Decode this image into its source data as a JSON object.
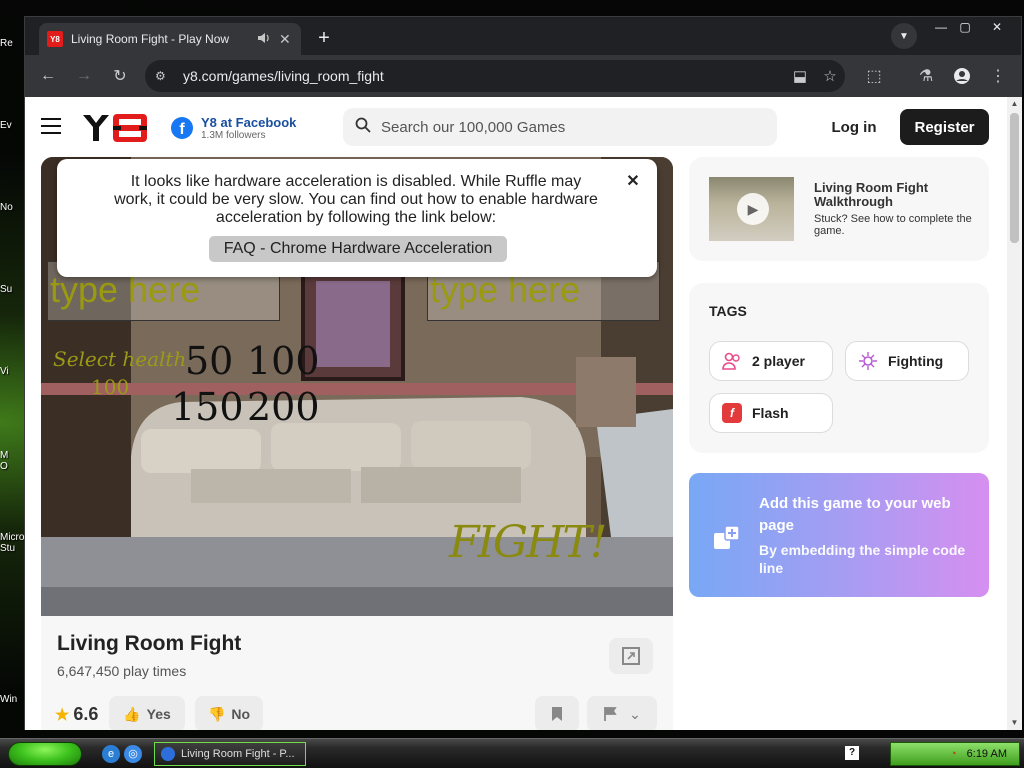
{
  "desktop": {
    "icons": [
      "Re",
      "Ev",
      "No",
      "Su",
      "Vi",
      "M\nO",
      "Micro\nStu",
      "Win"
    ]
  },
  "browser": {
    "tab": {
      "favicon": "Y8",
      "title": "Living Room Fight - Play Now",
      "audio_icon": "speaker-icon",
      "close_glyph": "✕"
    },
    "new_tab_glyph": "+",
    "window_controls": [
      "—",
      "▢",
      "✕"
    ],
    "address": {
      "url": "y8.com/games/living_room_fight"
    }
  },
  "site": {
    "search": {
      "placeholder": "Search our 100,000 Games"
    },
    "facebook": {
      "title": "Y8 at Facebook",
      "followers": "1.3M followers"
    },
    "login_label": "Log in",
    "register_label": "Register"
  },
  "game": {
    "input_placeholder_left": "type here",
    "input_placeholder_right": "type here",
    "select_health_label": "Select health",
    "current_health": "100",
    "health_options": [
      "50",
      "100",
      "150",
      "200"
    ],
    "fight_label": "FIGHT!"
  },
  "notice": {
    "message": "It looks like hardware acceleration is disabled. While Ruffle may work, it could be very slow. You can find out how to enable hardware acceleration by following the link below:",
    "link_label": "FAQ - Chrome Hardware Acceleration",
    "close_glyph": "✕"
  },
  "game_info": {
    "title": "Living Room Fight",
    "plays": "6,647,450 play times",
    "rating": "6.6",
    "yes_label": "Yes",
    "no_label": "No"
  },
  "walkthrough": {
    "title": "Living Room Fight Walkthrough",
    "subtitle": "Stuck? See how to complete the game."
  },
  "tags": {
    "heading": "TAGS",
    "items": [
      {
        "label": "2 player",
        "icon": "two-player-icon",
        "color": "#e84b8a"
      },
      {
        "label": "Fighting",
        "icon": "fighting-icon",
        "color": "#b85ad6"
      },
      {
        "label": "Flash",
        "icon": "flash-icon",
        "color": "#e33b3b"
      }
    ]
  },
  "embed": {
    "title": "Add this game to your web page",
    "subtitle": "By embedding the simple code line"
  },
  "taskbar": {
    "active_window": "Living Room Fight - P...",
    "clock": "6:19 AM",
    "help_glyph": "?"
  },
  "colors": {
    "brand_red": "#e21b1b",
    "register_bg": "#1c1c1c",
    "facebook_blue": "#1877f2",
    "embed_gradient_start": "#78a8f5",
    "embed_gradient_end": "#d68ff0"
  }
}
